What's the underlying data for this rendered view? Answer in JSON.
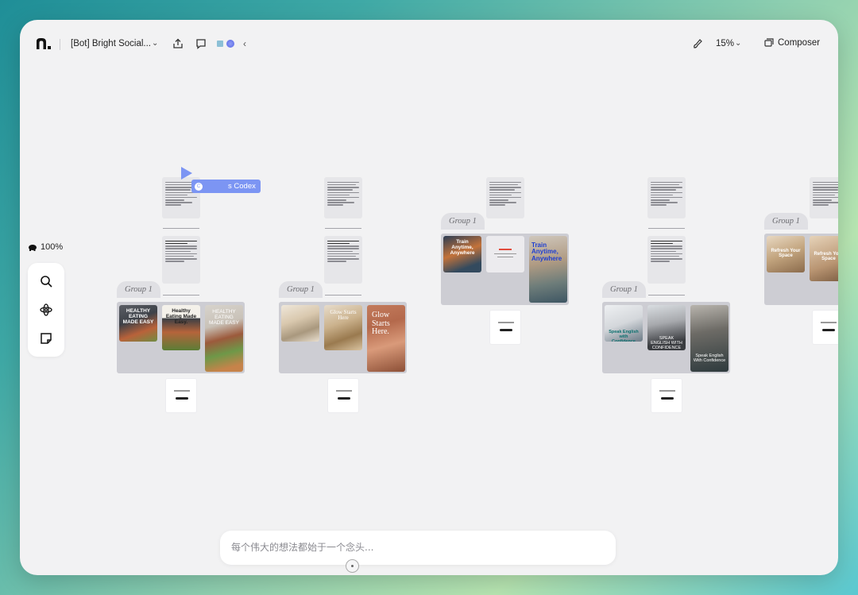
{
  "app": {
    "title": "[Bot] Bright Social...",
    "zoom": "15%",
    "composer_label": "Composer"
  },
  "left_toolbar": {
    "zoom_percent": "100%",
    "tools": [
      "search-icon",
      "component-icon",
      "sticky-note-icon"
    ]
  },
  "collaborator": {
    "name_tag": "s Codex",
    "initial": "C",
    "color": "#7c95f3"
  },
  "canvas": {
    "groups": [
      {
        "label": "Group 1",
        "cards": [
          "HEALTHY EATING MADE EASY",
          "Healthy Eating Made Easy.",
          "HEALTHY EATING MADE EASY"
        ]
      },
      {
        "label": "Group 1",
        "cards": [
          "",
          "Glow Starts Here",
          "Glow Starts Here."
        ]
      },
      {
        "label": "Group 1",
        "cards": [
          "Train Anytime, Anywhere",
          "",
          "Train Anytime, Anywhere"
        ]
      },
      {
        "label": "Group 1",
        "cards": [
          "Speak English with Confidence",
          "SPEAK ENGLISH WITH CONFIDENCE",
          "Speak English With Confidence"
        ]
      },
      {
        "label": "Group 1",
        "cards": [
          "Refresh Your Space",
          "Refresh Your Space"
        ]
      }
    ]
  },
  "chat": {
    "placeholder": "每个伟大的想法都始于一个念头..."
  },
  "colors": {
    "accent": "#7c95f3",
    "window_bg": "#f2f2f3",
    "group_box": "#cdcdd3"
  }
}
